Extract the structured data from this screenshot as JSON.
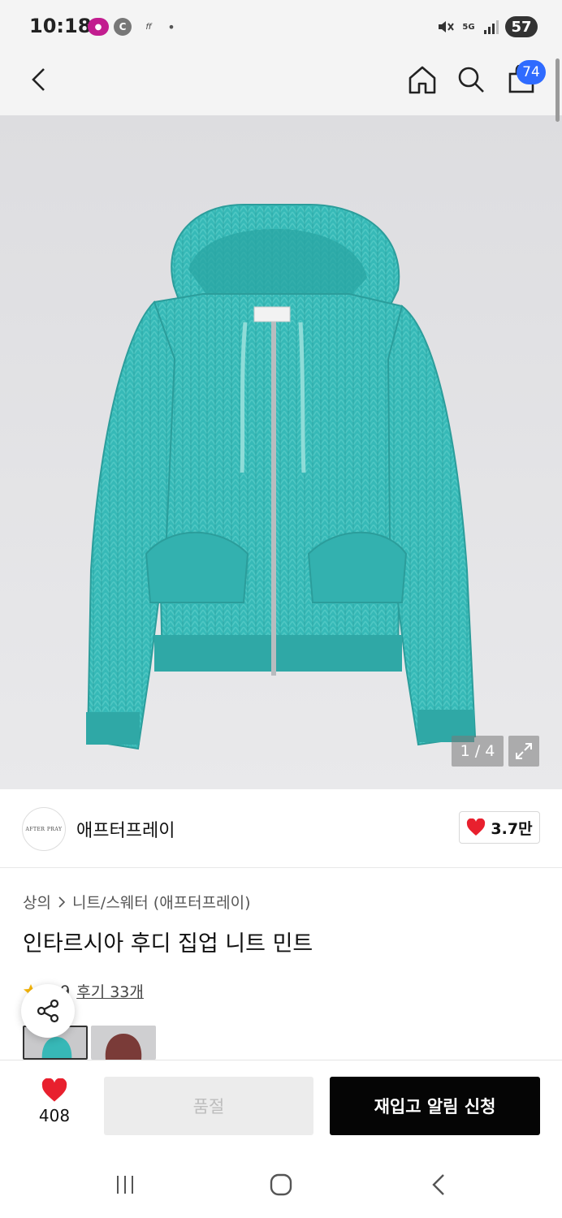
{
  "status_bar": {
    "time": "10:18",
    "battery": "57",
    "network": "5G"
  },
  "app_bar": {
    "cart_count": "74"
  },
  "gallery": {
    "pager": "1 / 4"
  },
  "brand": {
    "logo_text": "AFTER PRAY",
    "name": "애프터프레이",
    "likes": "3.7만"
  },
  "breadcrumb": {
    "category": "상의",
    "subcategory": "니트/스웨터 (애프터프레이)"
  },
  "product": {
    "title": "인타르시아 후디 집업 니트 민트",
    "rating": "4.9",
    "reviews": "후기 33개"
  },
  "variants": [
    {
      "name": "mint",
      "color": "#37b8b7"
    },
    {
      "name": "burgundy",
      "color": "#7a3b38"
    }
  ],
  "bottom_bar": {
    "wish_count": "408",
    "soldout_label": "품절",
    "restock_label": "재입고 알림 신청"
  },
  "colors": {
    "accent": "#2f6bff",
    "heart": "#e8202e",
    "garment": "#36b9b7"
  }
}
